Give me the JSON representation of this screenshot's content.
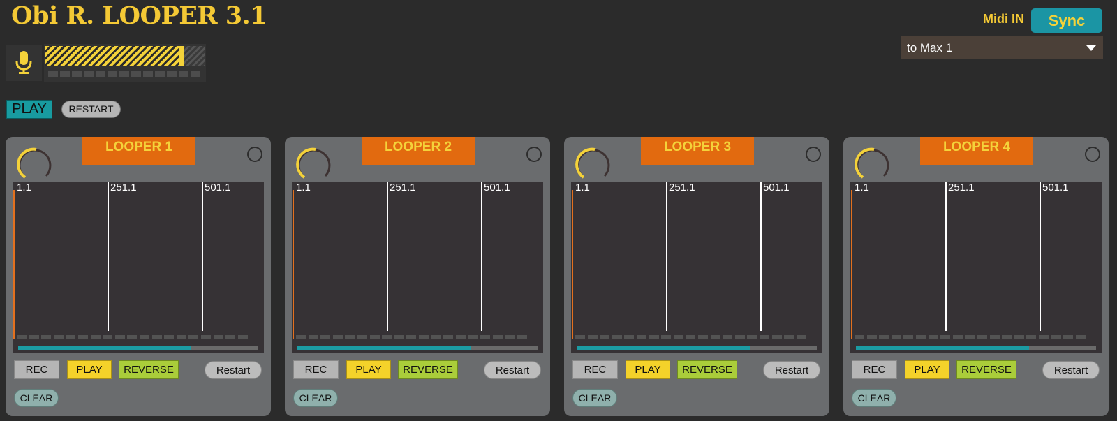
{
  "app_title": "Obi R. LOOPER 3.1",
  "input": {
    "mic_icon": "microphone-icon",
    "level_fraction": 0.87
  },
  "transport": {
    "play_label": "PLAY",
    "restart_label": "RESTART"
  },
  "midi": {
    "label": "Midi IN",
    "sync_label": "Sync",
    "selected_port": "to Max 1"
  },
  "colors": {
    "accent_yellow": "#f4c935",
    "teal": "#1b95a4",
    "orange": "#e26a0f",
    "reverse_green": "#aacd3a"
  },
  "loopers": [
    {
      "title": "LOOPER 1",
      "markers": [
        "1.1",
        "251.1",
        "501.1"
      ],
      "progress_fraction": 0.72,
      "buttons": {
        "rec": "REC",
        "play": "PLAY",
        "reverse": "REVERSE",
        "restart": "Restart",
        "clear": "CLEAR"
      }
    },
    {
      "title": "LOOPER 2",
      "markers": [
        "1.1",
        "251.1",
        "501.1"
      ],
      "progress_fraction": 0.72,
      "buttons": {
        "rec": "REC",
        "play": "PLAY",
        "reverse": "REVERSE",
        "restart": "Restart",
        "clear": "CLEAR"
      }
    },
    {
      "title": "LOOPER 3",
      "markers": [
        "1.1",
        "251.1",
        "501.1"
      ],
      "progress_fraction": 0.72,
      "buttons": {
        "rec": "REC",
        "play": "PLAY",
        "reverse": "REVERSE",
        "restart": "Restart",
        "clear": "CLEAR"
      }
    },
    {
      "title": "LOOPER 4",
      "markers": [
        "1.1",
        "251.1",
        "501.1"
      ],
      "progress_fraction": 0.72,
      "buttons": {
        "rec": "REC",
        "play": "PLAY",
        "reverse": "REVERSE",
        "restart": "Restart",
        "clear": "CLEAR"
      }
    }
  ]
}
